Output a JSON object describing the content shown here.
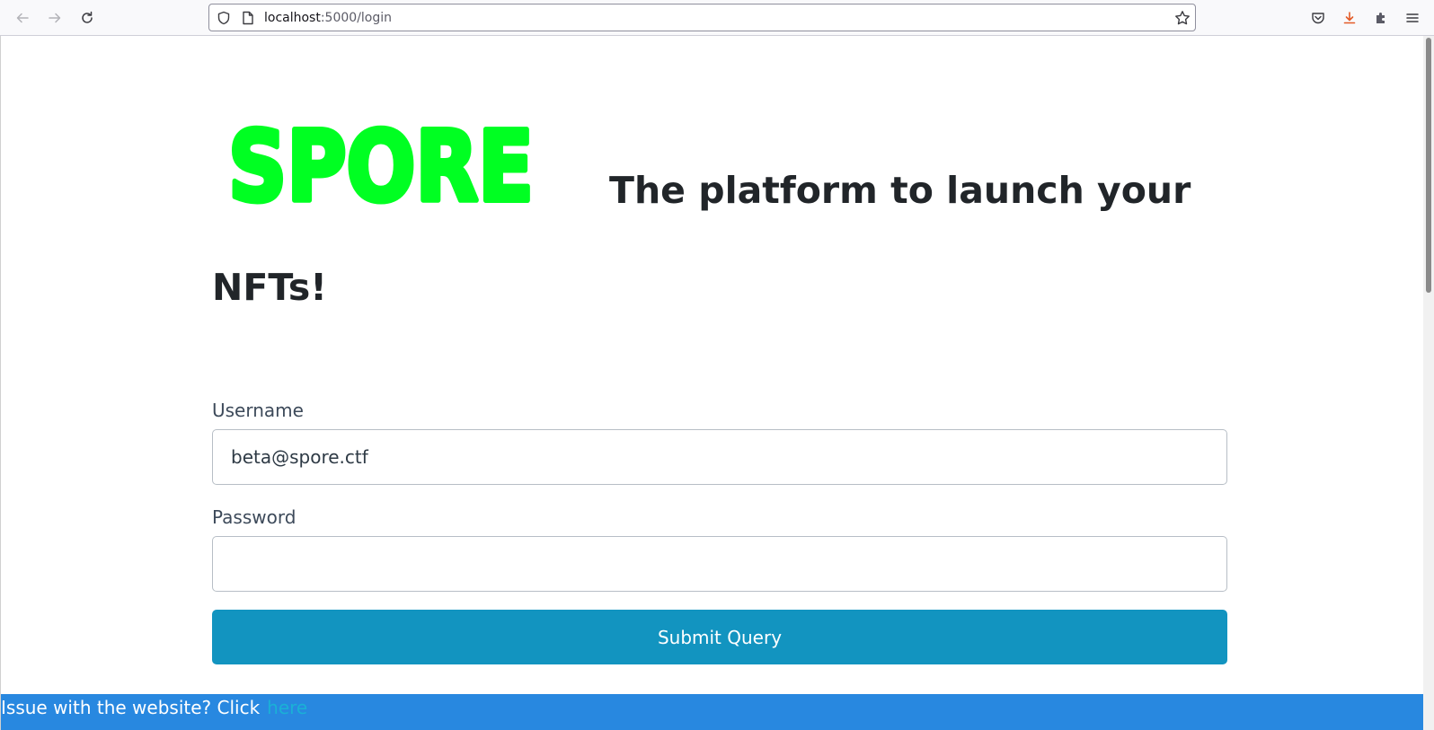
{
  "browser": {
    "url_host": "localhost",
    "url_rest": ":5000/login",
    "icons": [
      "back-icon",
      "forward-icon",
      "reload-icon",
      "shield-icon",
      "page-icon",
      "bookmark-star-icon",
      "pocket-icon",
      "download-icon",
      "extensions-icon",
      "menu-icon"
    ],
    "download_icon_color": "#e35b27"
  },
  "page": {
    "logo_text": "SPORE",
    "logo_color": "#00ff22",
    "tagline": "The platform to launch your NFTs!",
    "form": {
      "username_label": "Username",
      "username_value": "beta@spore.ctf",
      "password_label": "Password",
      "password_value": "",
      "submit_label": "Submit Query"
    },
    "footer": {
      "issue_text": "Issue with the website? Click",
      "issue_link": "here"
    },
    "colors": {
      "button": "#1294c0",
      "footer_bar": "#2888e0",
      "heading": "#212529"
    }
  }
}
